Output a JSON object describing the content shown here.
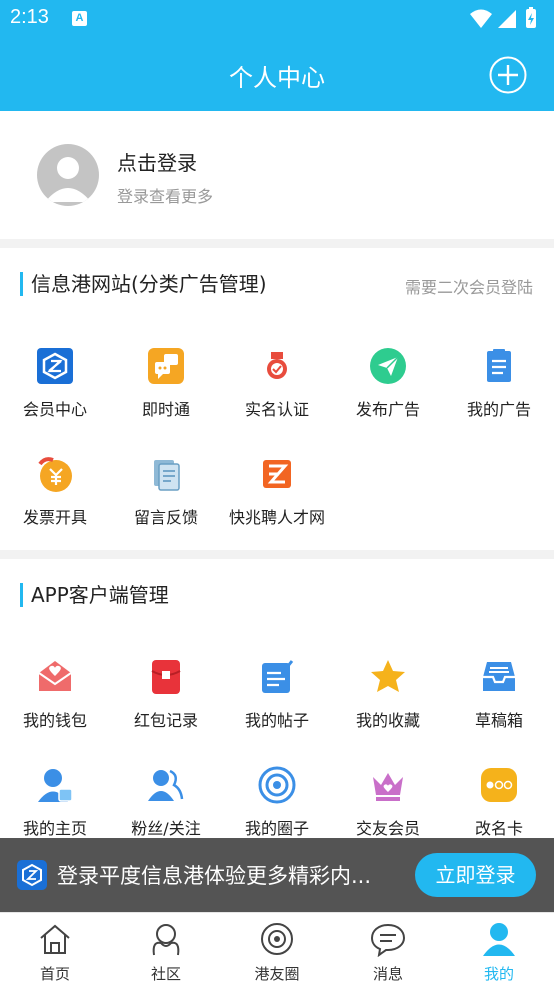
{
  "status_bar": {
    "time": "2:13",
    "notification_icon": "A"
  },
  "header": {
    "title": "个人中心",
    "add_icon": "plus-circle-icon"
  },
  "user": {
    "title": "点击登录",
    "subtitle": "登录查看更多"
  },
  "section_website": {
    "title": "信息港网站(分类广告管理)",
    "note": "需要二次会员登陆",
    "items": [
      {
        "label": "会员中心",
        "icon": "member-center-icon"
      },
      {
        "label": "即时通",
        "icon": "instant-messaging-icon"
      },
      {
        "label": "实名认证",
        "icon": "real-name-badge-icon"
      },
      {
        "label": "发布广告",
        "icon": "publish-ad-icon"
      },
      {
        "label": "我的广告",
        "icon": "my-ads-clipboard-icon"
      },
      {
        "label": "发票开具",
        "icon": "invoice-icon"
      },
      {
        "label": "留言反馈",
        "icon": "feedback-icon"
      },
      {
        "label": "快兆聘人才网",
        "icon": "recruit-icon"
      }
    ]
  },
  "section_app": {
    "title": "APP客户端管理",
    "items": [
      {
        "label": "我的钱包",
        "icon": "wallet-envelope-icon"
      },
      {
        "label": "红包记录",
        "icon": "red-packet-icon"
      },
      {
        "label": "我的帖子",
        "icon": "my-posts-icon"
      },
      {
        "label": "我的收藏",
        "icon": "star-icon"
      },
      {
        "label": "草稿箱",
        "icon": "drafts-tray-icon"
      },
      {
        "label": "我的主页",
        "icon": "my-homepage-icon"
      },
      {
        "label": "粉丝/关注",
        "icon": "fans-icon"
      },
      {
        "label": "我的圈子",
        "icon": "circle-target-icon"
      },
      {
        "label": "交友会员",
        "icon": "crown-icon"
      },
      {
        "label": "改名卡",
        "icon": "rename-card-icon"
      }
    ]
  },
  "banner": {
    "text": "登录平度信息港体验更多精彩内...",
    "button": "立即登录"
  },
  "tabs": [
    {
      "label": "首页",
      "icon": "home-icon"
    },
    {
      "label": "社区",
      "icon": "community-icon"
    },
    {
      "label": "港友圈",
      "icon": "friends-circle-icon"
    },
    {
      "label": "消息",
      "icon": "message-icon"
    },
    {
      "label": "我的",
      "icon": "profile-icon"
    }
  ],
  "colors": {
    "primary": "#22b8f0",
    "text": "#222222",
    "muted": "#999999",
    "banner_bg": "#484848"
  }
}
